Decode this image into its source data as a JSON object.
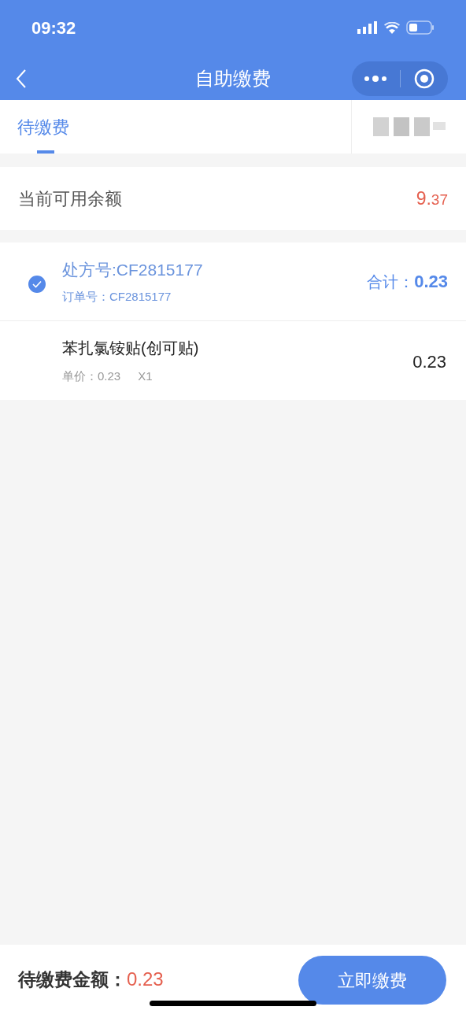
{
  "status_bar": {
    "time": "09:32"
  },
  "nav": {
    "title": "自助缴费"
  },
  "tabs": [
    {
      "label": "待缴费",
      "selected": true
    },
    {
      "blurred": true,
      "selected": false
    }
  ],
  "balance": {
    "label": "当前可用余额",
    "integer": "9.",
    "fraction": "37"
  },
  "prescriptions": [
    {
      "checked": true,
      "title": "处方号:CF2815177",
      "order": "订单号：CF2815177",
      "total_label": "合计：",
      "total": "0.23",
      "items": [
        {
          "name": "苯扎氯铵贴(创可贴)",
          "unit_price": "单价：0.23",
          "quantity": "X1",
          "amount": "0.23"
        }
      ]
    }
  ],
  "footer": {
    "label": "待缴费金额：",
    "amount": "0.23",
    "button": "立即缴费"
  }
}
